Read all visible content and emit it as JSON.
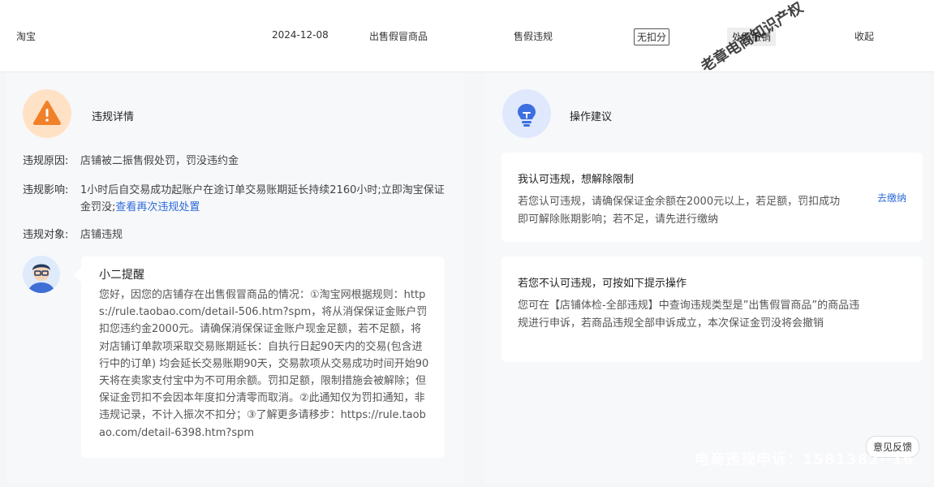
{
  "topbar": {
    "platform": "淘宝",
    "date": "2024-12-08",
    "violation_type": "出售假冒商品",
    "category": "售假违规",
    "deduct_tag": "无扣分",
    "penalty_tag": "处罚撤销",
    "collapse_link": "收起"
  },
  "left": {
    "title": "违规详情",
    "reason_label": "违规原因:",
    "reason_value": "店铺被二振售假处罚，罚没违约金",
    "impact_label": "违规影响:",
    "impact_value": "1小时后自交易成功起账户在途订单交易账期延长持续2160小时;立即淘宝保证金罚没;",
    "impact_link": "查看再次违规处置",
    "target_label": "违规对象:",
    "target_value": "店铺违规",
    "reminder_title": "小二提醒",
    "reminder_body": "您好，因您的店铺存在出售假冒商品的情况：①淘宝网根据规则：https://rule.taobao.com/detail-506.htm?spm，将从消保保证金账户罚扣您违约金2000元。请确保消保保证金账户现金足额，若不足额，将对店铺订单款项采取交易账期延长：自执行日起90天内的交易(包含进行中的订单) 均会延长交易账期90天，交易款项从交易成功时间开始90天将在卖家支付宝中为不可用余额。罚扣足额，限制措施会被解除；但保证金罚扣不会因本年度扣分清零而取消。②此通知仅为罚扣通知，非违规记录，不计入振次不扣分；③了解更多请移步：https://rule.taobao.com/detail-6398.htm?spm"
  },
  "right": {
    "title": "操作建议",
    "card1_title": "我认可违规，想解除限制",
    "card1_body": "若您认可违规，请确保保证金余额在2000元以上，若足额，罚扣成功即可解除账期影响；若不足，请先进行缴纳",
    "card1_action": "去缴纳",
    "card2_title": "若您不认可违规，可按如下提示操作",
    "card2_body": "您可在【店铺体检-全部违规】中查询违规类型是”出售假冒商品”的商品违规进行申诉，若商品违规全部申诉成立，本次保证金罚没将会撤销"
  },
  "feedback": "意见反馈",
  "watermark_diag": "老章电商知识产权",
  "watermark_bottom": "电商违规申诉：1581382··16",
  "colors": {
    "link": "#2f6bd8",
    "warn": "#f0812a",
    "bulb": "#3d6fe0"
  }
}
